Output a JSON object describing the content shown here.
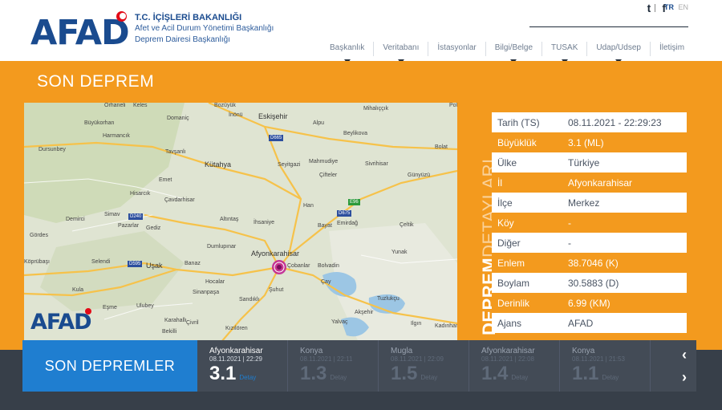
{
  "header": {
    "logo": "AFAD",
    "org_line1": "T.C. İÇİŞLERİ BAKANLIĞI",
    "org_line2": "Afet ve Acil Durum Yönetimi Başkanlığı",
    "org_line3": "Deprem Dairesi Başkanlığı",
    "social": [
      "t",
      "f"
    ],
    "lang_active": "TR",
    "lang_other": "EN",
    "nav": [
      {
        "label": "Başkanlık",
        "caret": true
      },
      {
        "label": "Veritabanı",
        "caret": true
      },
      {
        "label": "İstasyonlar",
        "caret": false
      },
      {
        "label": "Bilgi/Belge",
        "caret": true
      },
      {
        "label": "TUSAK",
        "caret": true
      },
      {
        "label": "Udap/Udsep",
        "caret": true
      },
      {
        "label": "İletişim",
        "caret": false
      }
    ]
  },
  "section_title": "SON DEPREM",
  "map": {
    "labels": [
      "Eskişehir",
      "Kütahya",
      "Afyonkarahisar",
      "Uşak",
      "Alpu",
      "Beylikova",
      "Mihalıççık",
      "Seyitgazi",
      "Mahmudiye",
      "Sivrihisar",
      "Günyüzü",
      "Çifteler",
      "Han",
      "Emirdağ",
      "Bayat",
      "İhsaniye",
      "Altıntaş",
      "Dumlupınar",
      "Çobanlar",
      "Bolvadin",
      "Şuhut",
      "Sandıklı",
      "Sinanpaşa",
      "Hocalar",
      "Çay",
      "Tuzlukçu",
      "Akşehir",
      "Yalvaç",
      "Yunak",
      "Çeltik",
      "Kadınhanı",
      "Ilgın",
      "Domaniç",
      "Tavşanlı",
      "Emet",
      "Hisarcık",
      "Çavdarhisar",
      "Simav",
      "Demirci",
      "Pazarlar",
      "Gediz",
      "Gördes",
      "Köprübaşı",
      "Selendi",
      "Banaz",
      "Kula",
      "Eşme",
      "Ulubey",
      "Karahallı",
      "Çivril",
      "Kızılören",
      "Bekilli",
      "Dursunbey",
      "Harmancık",
      "Büyükorhan",
      "İnönü",
      "Bozüyük",
      "Orhaneli",
      "Keles",
      "Polatlı",
      "Bolat"
    ],
    "roads": [
      "D665",
      "D240",
      "D675",
      "E96",
      "D595"
    ],
    "logo": "AFAD"
  },
  "side_label_bold": "DEPREM",
  "side_label_light": "DETAYLARI",
  "details": [
    {
      "key": "Tarih (TS)",
      "value": "08.11.2021 - 22:29:23"
    },
    {
      "key": "Büyüklük",
      "value": "3.1 (ML)"
    },
    {
      "key": "Ülke",
      "value": "Türkiye"
    },
    {
      "key": "İl",
      "value": "Afyonkarahisar"
    },
    {
      "key": "İlçe",
      "value": "Merkez"
    },
    {
      "key": "Köy",
      "value": "-"
    },
    {
      "key": "Diğer",
      "value": "-"
    },
    {
      "key": "Enlem",
      "value": "38.7046 (K)"
    },
    {
      "key": "Boylam",
      "value": "30.5883 (D)"
    },
    {
      "key": "Derinlik",
      "value": "6.99 (KM)"
    },
    {
      "key": "Ajans",
      "value": "AFAD"
    }
  ],
  "recent": {
    "title": "SON DEPREMLER",
    "detail_label": "Detay",
    "items": [
      {
        "place": "Afyonkarahisar",
        "date": "08.11.2021 | 22:29",
        "mag": "3.1"
      },
      {
        "place": "Konya",
        "date": "08.11.2021 | 22:11",
        "mag": "1.3"
      },
      {
        "place": "Mugla",
        "date": "08.11.2021 | 22:09",
        "mag": "1.5"
      },
      {
        "place": "Afyonkarahisar",
        "date": "08.11.2021 | 22:08",
        "mag": "1.4"
      },
      {
        "place": "Konya",
        "date": "08.11.2021 | 21:53",
        "mag": "1.1"
      }
    ],
    "prev": "‹",
    "next": "›"
  }
}
